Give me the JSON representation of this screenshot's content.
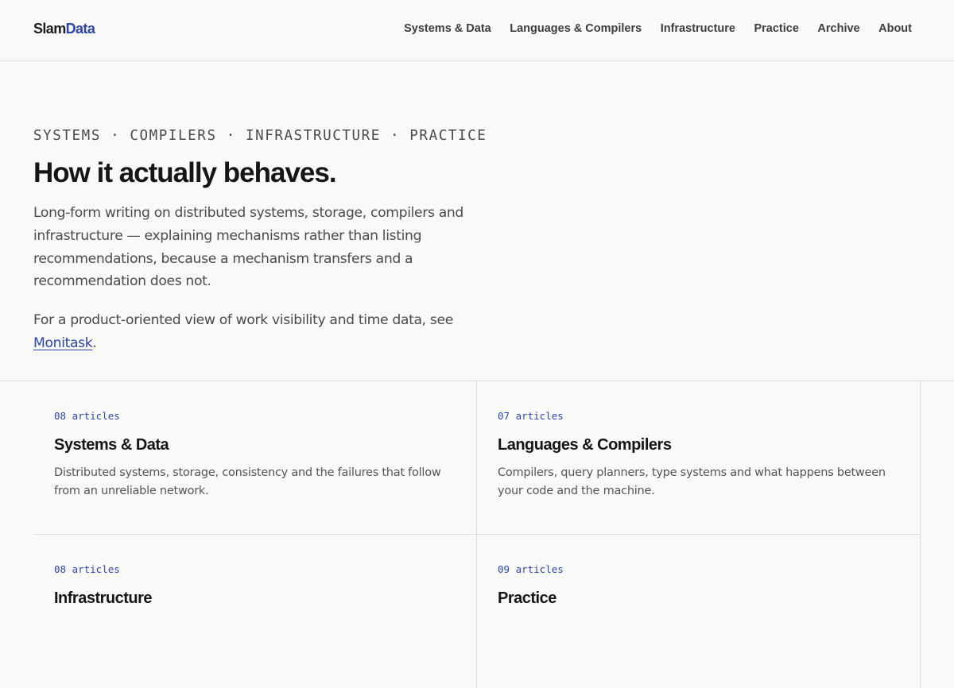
{
  "header": {
    "logo": {
      "part1": "Slam",
      "part2": "Data"
    },
    "nav": [
      {
        "label": "Systems & Data"
      },
      {
        "label": "Languages & Compilers"
      },
      {
        "label": "Infrastructure"
      },
      {
        "label": "Practice"
      },
      {
        "label": "Archive"
      },
      {
        "label": "About"
      }
    ]
  },
  "hero": {
    "eyebrow": "SYSTEMS · COMPILERS · INFRASTRUCTURE · PRACTICE",
    "title": "How it actually behaves.",
    "lede": "Long-form writing on distributed systems, storage, compilers and infrastructure — explaining mechanisms rather than listing recommendations, because a mechanism transfers and a recommendation does not.",
    "note_before": "For a product-oriented view of work visibility and time data, see ",
    "note_link": "Monitask",
    "note_after": "."
  },
  "sections": [
    {
      "count": "08 articles",
      "title": "Systems & Data",
      "description": "Distributed systems, storage, consistency and the failures that follow from an unreliable network."
    },
    {
      "count": "07 articles",
      "title": "Languages & Compilers",
      "description": "Compilers, query planners, type systems and what happens between your code and the machine."
    },
    {
      "count": "08 articles",
      "title": "Infrastructure",
      "description": ""
    },
    {
      "count": "09 articles",
      "title": "Practice",
      "description": ""
    }
  ],
  "colors": {
    "accent": "#2d47a8",
    "background": "#f9f9f7",
    "border": "#dcdcd8",
    "text": "#161616",
    "muted": "#4a4a4a"
  }
}
